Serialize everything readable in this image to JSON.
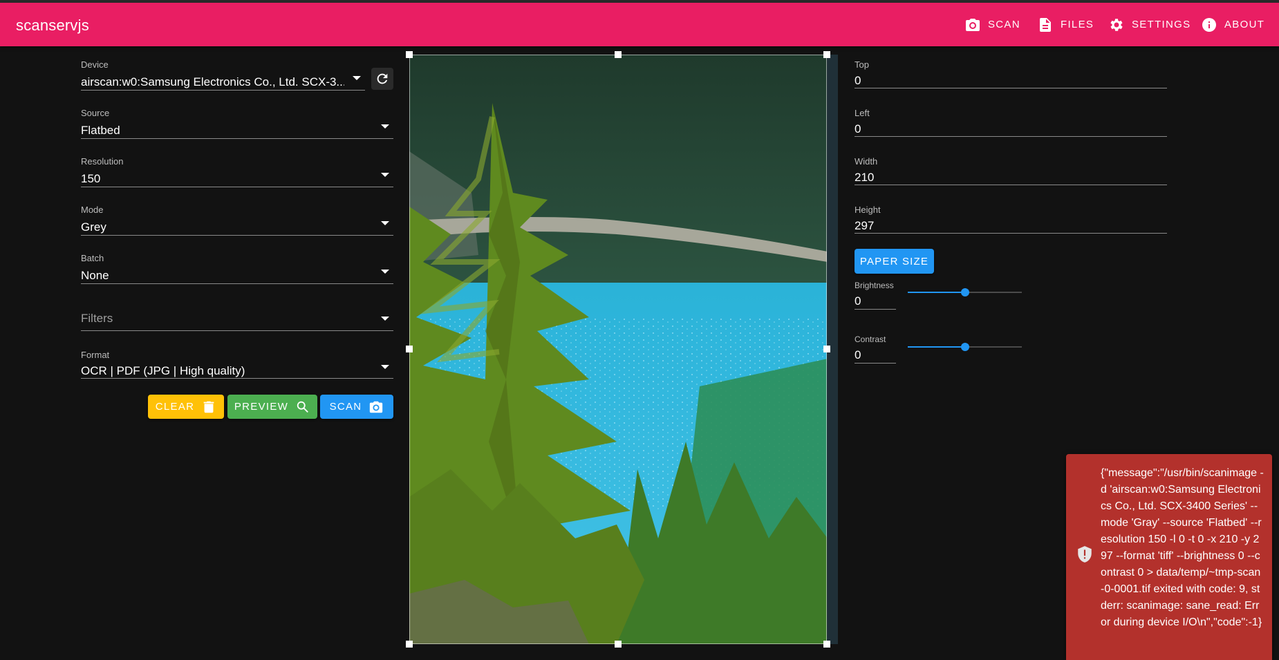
{
  "app": {
    "title": "scanservjs"
  },
  "nav": {
    "scan": "SCAN",
    "files": "FILES",
    "settings": "SETTINGS",
    "about": "ABOUT"
  },
  "form": {
    "device": {
      "label": "Device",
      "value": "airscan:w0:Samsung Electronics Co., Ltd. SCX-3..."
    },
    "source": {
      "label": "Source",
      "value": "Flatbed"
    },
    "resolution": {
      "label": "Resolution",
      "value": "150"
    },
    "mode": {
      "label": "Mode",
      "value": "Grey"
    },
    "batch": {
      "label": "Batch",
      "value": "None"
    },
    "filters": {
      "placeholder": "Filters"
    },
    "format": {
      "label": "Format",
      "value": "OCR | PDF (JPG | High quality)"
    }
  },
  "buttons": {
    "clear": "CLEAR",
    "preview": "PREVIEW",
    "scan": "SCAN"
  },
  "geometry": {
    "top": {
      "label": "Top",
      "value": "0"
    },
    "left": {
      "label": "Left",
      "value": "0"
    },
    "width": {
      "label": "Width",
      "value": "210"
    },
    "height": {
      "label": "Height",
      "value": "297"
    },
    "paper_size": "PAPER SIZE"
  },
  "adjust": {
    "brightness": {
      "label": "Brightness",
      "value": "0",
      "slider_fraction": 0.5
    },
    "contrast": {
      "label": "Contrast",
      "value": "0",
      "slider_fraction": 0.5
    }
  },
  "error": {
    "message": "{\"message\":\"/usr/bin/scanimage -d 'airscan:w0:Samsung Electronics Co., Ltd. SCX-3400 Series' --mode 'Gray' --source 'Flatbed' --resolution 150 -l 0 -t 0 -x 210 -y 297 --format 'tiff' --brightness 0 --contrast 0 > data/temp/~tmp-scan-0-0001.tif exited with code: 9, stderr: scanimage: sane_read: Error during device I/O\\n\",\"code\":-1}"
  },
  "colors": {
    "app_bar": "#e91e63",
    "clear": "#ffc107",
    "preview": "#4caf50",
    "scan": "#2196f3",
    "error": "#b3312c"
  },
  "icons": {
    "scan": "camera-icon",
    "files": "file-document-icon",
    "settings": "gear-icon",
    "about": "info-icon",
    "refresh": "refresh-icon",
    "clear": "trash-icon",
    "preview": "magnify-icon",
    "error": "shield-alert-icon"
  }
}
